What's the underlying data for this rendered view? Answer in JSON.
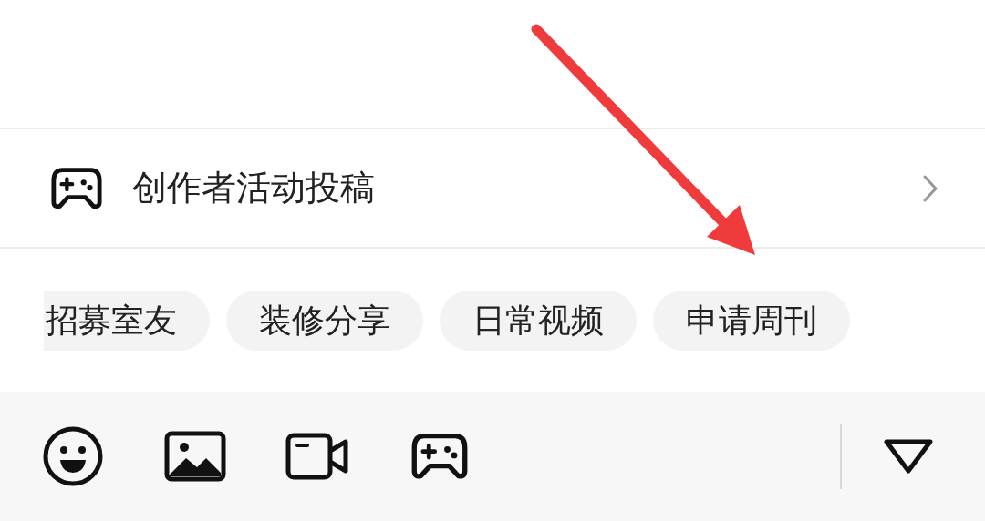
{
  "menu_item": {
    "label": "创作者活动投稿"
  },
  "tags": [
    {
      "label": "招募室友"
    },
    {
      "label": "装修分享"
    },
    {
      "label": "日常视频"
    },
    {
      "label": "申请周刊"
    }
  ],
  "toolbar": {
    "buttons": [
      {
        "kind": "emoji"
      },
      {
        "kind": "image"
      },
      {
        "kind": "video"
      },
      {
        "kind": "game"
      }
    ]
  }
}
